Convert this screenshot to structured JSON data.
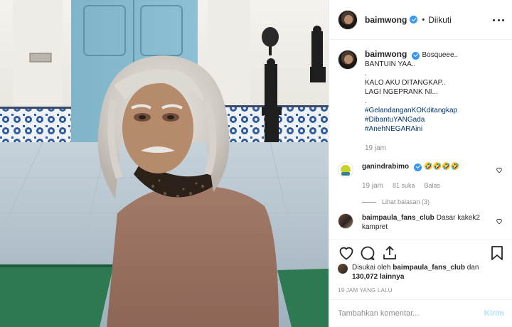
{
  "post": {
    "username": "baimwong",
    "follow_separator": "•",
    "follow_state": "Diikuti"
  },
  "caption": {
    "username": "baimwong",
    "lines": [
      "Bosqueee..",
      "BANTUIN YAA..",
      ".",
      "KALO AKU DITANGKAP..",
      "LAGI NGEPRANK NI...",
      "."
    ],
    "hashtags": [
      "#GelandanganKOKditangkap",
      "#DibantuYANGada",
      "#AnehNEGARAini"
    ],
    "time": "19 jam"
  },
  "comments": [
    {
      "username": "ganindrabimo",
      "text": "🤣🤣🤣🤣",
      "time": "19 jam",
      "likes": "81 suka",
      "reply_label": "Balas",
      "view_replies": "Lihat balasan (3)"
    },
    {
      "username": "baimpaula_fans_club",
      "text": "Dasar kakek2 kampret"
    }
  ],
  "likes": {
    "prefix": "Disukai oleh",
    "user": "baimpaula_fans_club",
    "conjunction": "dan",
    "count": "130,072",
    "suffix": "lainnya"
  },
  "post_date": "19 JAM YANG LALU",
  "comment_box": {
    "placeholder": "Tambahkan komentar...",
    "submit_label": "Kirim"
  },
  "colors": {
    "link_blue": "#003569",
    "verified_blue": "#3897f0",
    "muted": "#8e8e8e",
    "submit_disabled": "#b2dffc"
  },
  "icons": [
    "more-options-icon",
    "verified-badge-icon",
    "heart-icon",
    "comment-icon",
    "share-icon",
    "bookmark-icon"
  ]
}
